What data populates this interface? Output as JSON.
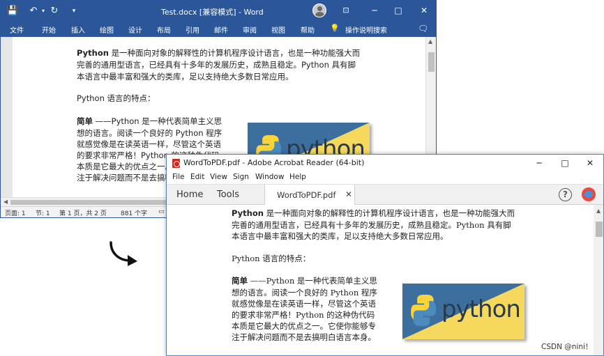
{
  "word": {
    "title": "Test.docx [兼容模式]  -  Word",
    "menu": [
      "文件",
      "开始",
      "插入",
      "绘图",
      "设计",
      "布局",
      "引用",
      "邮件",
      "审阅",
      "视图",
      "帮助",
      "操作说明搜索"
    ],
    "status": [
      "页面: 1",
      "节: 1",
      "第 1 页，共 2 页",
      "881 个字"
    ],
    "body": {
      "p1_bold": "Python",
      "p1_l1": " 是一种面向对象的解释性的计算机程序设计语言，也是一种功能强大而",
      "p1_l2": "完善的通用型语言，已经具有十多年的发展历史，成熟且稳定。Python 具有脚",
      "p1_l3": "本语言中最丰富和强大的类库，足以支持绝大多数日常应用。",
      "p2": "Python 语言的特点：",
      "p3_bold": "简单",
      "p3_l1": " ——Python 是一种代表简单主义思",
      "p3_l2": "想的语言。阅读一个良好的 Python 程序",
      "p3_l3": "就感觉像是在读英语一样，尽管这个英语",
      "p3_l4": "的要求非常严格！Python 的这种伪代码",
      "p3_l5": "本质是它最大的优点之一。它使你能够专",
      "p3_l6": "注于解决问题而不是去搞明白语言本身。"
    }
  },
  "logo_text": "python",
  "acrobat": {
    "title": "WordToPDF.pdf - Adobe Acrobat Reader (64-bit)",
    "menu": [
      "File",
      "Edit",
      "View",
      "Sign",
      "Window",
      "Help"
    ],
    "tabs": {
      "home": "Home",
      "tools": "Tools",
      "doc": "WordToPDF.pdf"
    },
    "help": "?",
    "body": {
      "p1_bold": "Python",
      "p1_l1": " 是一种面向对象的解释性的计算机程序设计语言，也是一种功能强大而",
      "p1_l2": "完善的通用型语言，已经具有十多年的发展历史，成熟且稳定。Python 具有脚",
      "p1_l3": "本语言中最丰富和强大的类库，足以支持绝大多数日常应用。",
      "p2": "Python 语言的特点：",
      "p3_bold": "简单",
      "p3_l1": " ——Python 是一种代表简单主义思",
      "p3_l2": "想的语言。阅读一个良好的 Python 程序",
      "p3_l3": "就感觉像是在读英语一样，尽管这个英语",
      "p3_l4": "的要求非常严格！Python 的这种伪代码",
      "p3_l5": "本质是它最大的优点之一。它使你能够专",
      "p3_l6": "注于解决问题而不是去搞明白语言本身。"
    }
  },
  "watermark": "CSDN @nini！",
  "colors": {
    "word_blue": "#2b579a",
    "logo_blue": "#3c6e9e",
    "logo_yellow": "#f5d85c"
  }
}
